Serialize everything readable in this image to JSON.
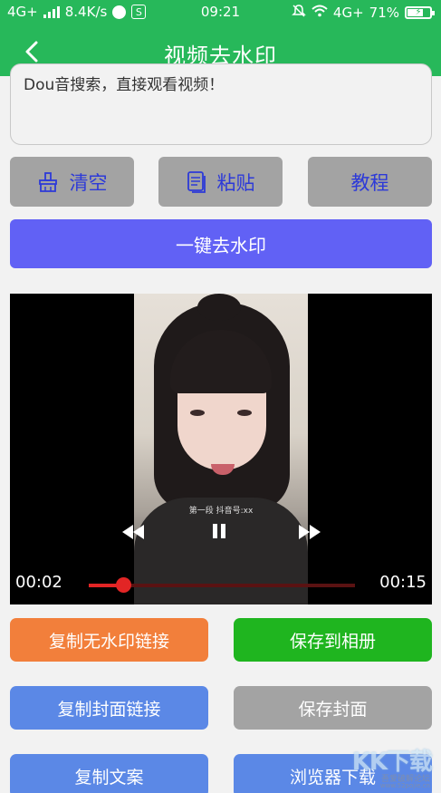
{
  "status_bar": {
    "network": "4G+",
    "speed": "8.4K/s",
    "app_badge": "S",
    "time": "09:21",
    "network_right": "4G+",
    "battery_percent": "71%",
    "battery_level": 0.71
  },
  "nav": {
    "title": "视频去水印"
  },
  "url_box": {
    "text": "Dou音搜索，直接观看视频！"
  },
  "buttons": {
    "clear": "清空",
    "paste": "粘贴",
    "tutorial": "教程",
    "remove_watermark": "一键去水印"
  },
  "player": {
    "caption": "第一段 抖音号:xx",
    "current_time": "00:02",
    "total_time": "00:15",
    "progress": 0.13,
    "icons": {
      "rewind": "rewind-icon",
      "play_pause": "pause-icon",
      "forward": "fast-forward-icon"
    }
  },
  "actions": {
    "copy_nowm_link": "复制无水印链接",
    "save_album": "保存到相册",
    "copy_cover_link": "复制封面链接",
    "save_cover": "保存封面",
    "copy_text": "复制文案",
    "browser_download": "浏览器下载"
  },
  "watermark": {
    "logo": "KK下载",
    "line1": "吾爱破解论坛",
    "line2": "www.52pojie.cn"
  },
  "colors": {
    "header": "#27b85a",
    "main_button": "#6161f5",
    "orange": "#f27f3b",
    "green": "#1fb51f",
    "blue": "#5b88e6",
    "gray": "#a3a3a3",
    "progress": "#e22525"
  }
}
